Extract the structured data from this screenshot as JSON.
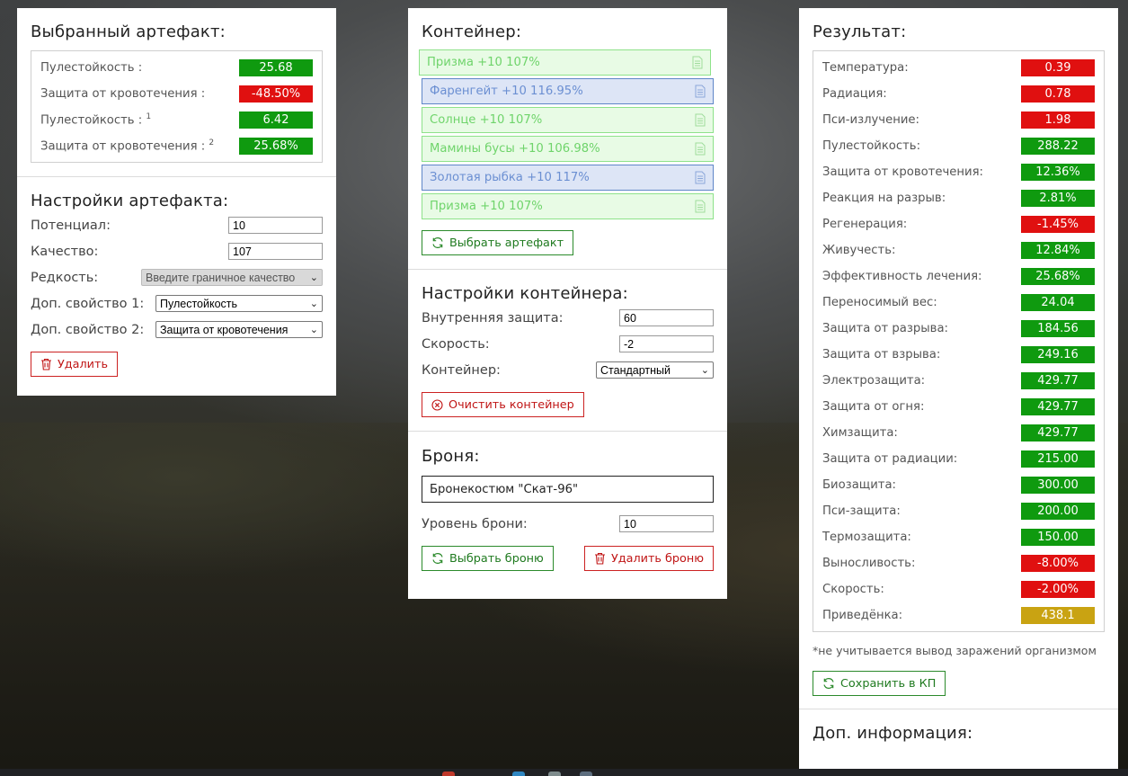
{
  "artifact": {
    "title": "Выбранный артефакт:",
    "stats": [
      {
        "label": "Пулестойкость :",
        "sup": "",
        "value": "25.68",
        "color": "green"
      },
      {
        "label": "Защита от кровотечения :",
        "sup": "",
        "value": "-48.50%",
        "color": "red"
      },
      {
        "label": "Пулестойкость :",
        "sup": "1",
        "value": "6.42",
        "color": "green"
      },
      {
        "label": "Защита от кровотечения :",
        "sup": "2",
        "value": "25.68%",
        "color": "green"
      }
    ]
  },
  "artifact_settings": {
    "title": "Настройки артефакта:",
    "potential_label": "Потенциал:",
    "potential_value": "10",
    "quality_label": "Качество:",
    "quality_value": "107",
    "rarity_label": "Редкость:",
    "rarity_value": "Введите граничное качество",
    "extra1_label": "Доп. свойство 1:",
    "extra1_value": "Пулестойкость",
    "extra2_label": "Доп. свойство 2:",
    "extra2_value": "Защита от кровотечения",
    "delete_label": "Удалить"
  },
  "container": {
    "title": "Контейнер:",
    "items": [
      {
        "label": "Призма +10 107%",
        "style": "green"
      },
      {
        "label": "Фаренгейт +10 116.95%",
        "style": "blue"
      },
      {
        "label": "Солнце +10 107%",
        "style": "green"
      },
      {
        "label": "Мамины бусы +10 106.98%",
        "style": "green"
      },
      {
        "label": "Золотая рыбка +10 117%",
        "style": "blue"
      },
      {
        "label": "Призма +10 107%",
        "style": "green"
      }
    ],
    "choose_label": "Выбрать артефакт"
  },
  "container_settings": {
    "title": "Настройки контейнера:",
    "inner_label": "Внутренняя защита:",
    "inner_value": "60",
    "speed_label": "Скорость:",
    "speed_value": "-2",
    "type_label": "Контейнер:",
    "type_value": "Стандартный",
    "clear_label": "Очистить контейнер"
  },
  "armor": {
    "title": "Броня:",
    "name": "Бронекостюм \"Скат-96\"",
    "level_label": "Уровень брони:",
    "level_value": "10",
    "choose_label": "Выбрать броню",
    "delete_label": "Удалить броню"
  },
  "result": {
    "title": "Результат:",
    "stats": [
      {
        "label": "Температура:",
        "value": "0.39",
        "color": "red"
      },
      {
        "label": "Радиация:",
        "value": "0.78",
        "color": "red"
      },
      {
        "label": "Пси-излучение:",
        "value": "1.98",
        "color": "red"
      },
      {
        "label": "Пулестойкость:",
        "value": "288.22",
        "color": "green"
      },
      {
        "label": "Защита от кровотечения:",
        "value": "12.36%",
        "color": "green"
      },
      {
        "label": "Реакция на разрыв:",
        "value": "2.81%",
        "color": "green"
      },
      {
        "label": "Регенерация:",
        "value": "-1.45%",
        "color": "red"
      },
      {
        "label": "Живучесть:",
        "value": "12.84%",
        "color": "green"
      },
      {
        "label": "Эффективность лечения:",
        "value": "25.68%",
        "color": "green"
      },
      {
        "label": "Переносимый вес:",
        "value": "24.04",
        "color": "green"
      },
      {
        "label": "Защита от разрыва:",
        "value": "184.56",
        "color": "green"
      },
      {
        "label": "Защита от взрыва:",
        "value": "249.16",
        "color": "green"
      },
      {
        "label": "Электрозащита:",
        "value": "429.77",
        "color": "green"
      },
      {
        "label": "Защита от огня:",
        "value": "429.77",
        "color": "green"
      },
      {
        "label": "Химзащита:",
        "value": "429.77",
        "color": "green"
      },
      {
        "label": "Защита от радиации:",
        "value": "215.00",
        "color": "green"
      },
      {
        "label": "Биозащита:",
        "value": "300.00",
        "color": "green"
      },
      {
        "label": "Пси-защита:",
        "value": "200.00",
        "color": "green"
      },
      {
        "label": "Термозащита:",
        "value": "150.00",
        "color": "green"
      },
      {
        "label": "Выносливость:",
        "value": "-8.00%",
        "color": "red"
      },
      {
        "label": "Скорость:",
        "value": "-2.00%",
        "color": "red"
      },
      {
        "label": "Приведёнка:",
        "value": "438.1",
        "color": "yellow"
      }
    ],
    "note": "*не учитывается вывод заражений организмом",
    "save_label": "Сохранить в КП",
    "extra_title": "Доп. информация:"
  },
  "colors": {
    "green": "#0f9a0f",
    "red": "#e01010",
    "yellow": "#c9a312",
    "container_green": "#e8fbe5",
    "container_blue": "#dde5f6"
  }
}
